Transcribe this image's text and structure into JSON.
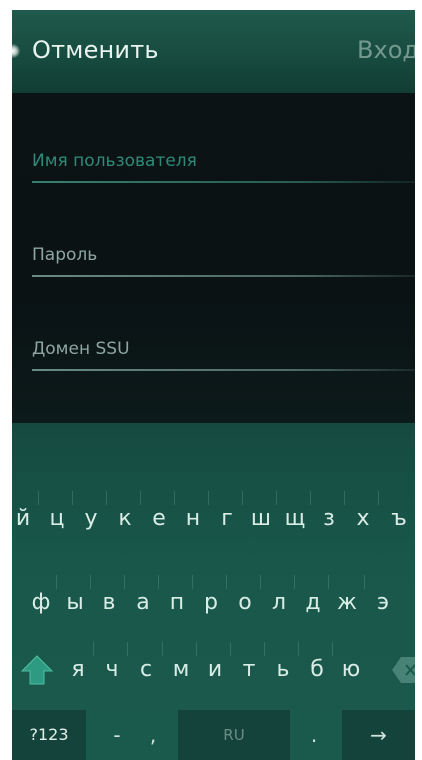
{
  "header": {
    "cancel_label": "Отменить",
    "login_label": "Вход"
  },
  "form": {
    "username_label": "Имя пользователя",
    "password_label": "Пароль",
    "domain_label": "Домен SSU"
  },
  "keyboard": {
    "row1": [
      "й",
      "ц",
      "у",
      "к",
      "е",
      "н",
      "г",
      "ш",
      "щ",
      "з",
      "х",
      "ъ"
    ],
    "row2": [
      "ф",
      "ы",
      "в",
      "а",
      "п",
      "р",
      "о",
      "л",
      "д",
      "ж",
      "э"
    ],
    "row3": [
      "я",
      "ч",
      "с",
      "м",
      "и",
      "т",
      "ь",
      "б",
      "ю"
    ],
    "symbols_label": "?123",
    "dash_label": "-",
    "comma_label": ",",
    "language_label": "RU",
    "period_label": ".",
    "enter_label": "→"
  },
  "colors": {
    "header": "#1f5a4c",
    "keyboard": "#19574a",
    "accent_field": "#2f8b78",
    "form_background": "#0b1315"
  },
  "icons": {
    "shift": "shift-arrow-icon",
    "backspace": "backspace-icon",
    "enter": "enter-arrow-icon"
  }
}
